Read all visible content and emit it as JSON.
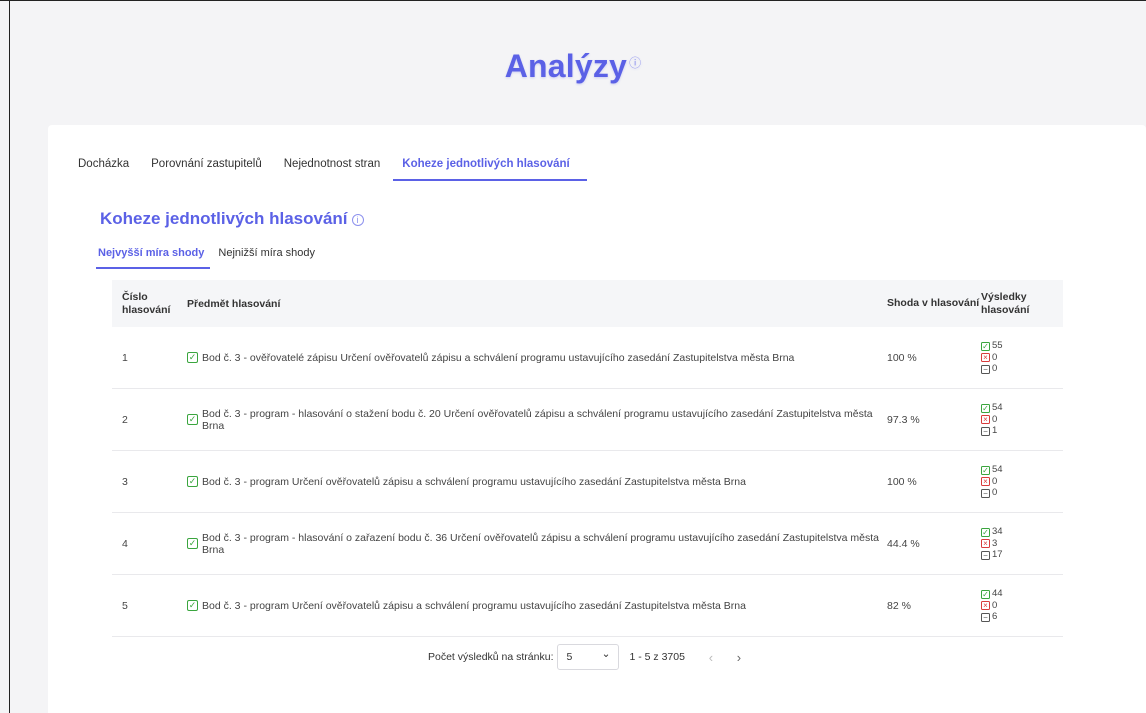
{
  "page": {
    "title": "Analýzy",
    "title_info": "ⓘ"
  },
  "tabs": [
    {
      "label": "Docházka",
      "active": false
    },
    {
      "label": "Porovnání zastupitelů",
      "active": false
    },
    {
      "label": "Nejednotnost stran",
      "active": false
    },
    {
      "label": "Koheze jednotlivých hlasování",
      "active": true
    }
  ],
  "section": {
    "title": "Koheze jednotlivých hlasování",
    "info": "i"
  },
  "subtabs": [
    {
      "label": "Nejvyšší míra shody",
      "active": true
    },
    {
      "label": "Nejnižší míra shody",
      "active": false
    }
  ],
  "table": {
    "headers": {
      "number": "Číslo hlasování",
      "subject": "Předmět hlasování",
      "agreement": "Shoda v hlasování",
      "results": "Výsledky hlasování"
    },
    "rows": [
      {
        "number": "1",
        "subject": "Bod č. 3 - ověřovatelé zápisu Určení ověřovatelů zápisu a schválení programu ustavujícího zasedání Zastupitelstva města Brna",
        "agreement": "100 %",
        "yes": "55",
        "no": "0",
        "abstain": "0"
      },
      {
        "number": "2",
        "subject": "Bod č. 3 - program - hlasování o stažení bodu č. 20 Určení ověřovatelů zápisu a schválení programu ustavujícího zasedání Zastupitelstva města Brna",
        "agreement": "97.3 %",
        "yes": "54",
        "no": "0",
        "abstain": "1"
      },
      {
        "number": "3",
        "subject": "Bod č. 3 - program Určení ověřovatelů zápisu a schválení programu ustavujícího zasedání Zastupitelstva města Brna",
        "agreement": "100 %",
        "yes": "54",
        "no": "0",
        "abstain": "0"
      },
      {
        "number": "4",
        "subject": "Bod č. 3 - program - hlasování o zařazení bodu č. 36 Určení ověřovatelů zápisu a schválení programu ustavujícího zasedání Zastupitelstva města Brna",
        "agreement": "44.4 %",
        "yes": "34",
        "no": "3",
        "abstain": "17"
      },
      {
        "number": "5",
        "subject": "Bod č. 3 - program Určení ověřovatelů zápisu a schválení programu ustavujícího zasedání Zastupitelstva města Brna",
        "agreement": "82 %",
        "yes": "44",
        "no": "0",
        "abstain": "6"
      }
    ]
  },
  "pagination": {
    "per_page_label": "Počet výsledků na stránku:",
    "per_page_value": "5",
    "range": "1 - 5 z 3705",
    "prev": "‹",
    "next": "›"
  },
  "colors": {
    "accent": "#5b61e6",
    "yes": "#3aa53e",
    "no": "#d93b3b"
  },
  "icons": {
    "check": "✓",
    "cross": "×",
    "minus": "−",
    "chevron_down": "⌄"
  }
}
